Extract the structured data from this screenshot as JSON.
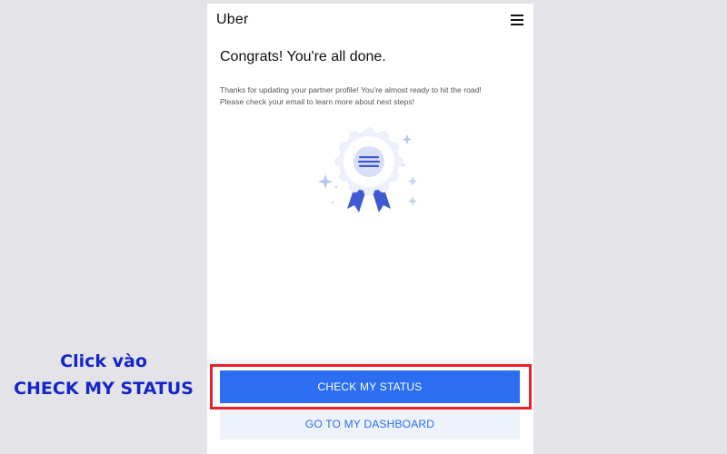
{
  "app": {
    "logo": "Uber",
    "menu_icon": "hamburger-menu-icon"
  },
  "main": {
    "title": "Congrats! You're all done.",
    "description_line1": "Thanks for updating your partner profile! You're almost ready to hit the road!",
    "description_line2": "Please check your email to learn more about next steps!",
    "illustration_icon": "award-ribbon-icon"
  },
  "actions": {
    "primary_label": "CHECK MY STATUS",
    "secondary_label": "GO TO MY DASHBOARD"
  },
  "annotation": {
    "line1": "Click vào",
    "line2": "CHECK MY STATUS"
  },
  "colors": {
    "background": "#e4e3e8",
    "primary": "#2b6ef2",
    "secondary_bg": "#eef2fb",
    "highlight_border": "#e8212b",
    "annotation_text": "#1426c9",
    "badge_blue": "#3f5bd1",
    "badge_light": "#d8dff7"
  }
}
